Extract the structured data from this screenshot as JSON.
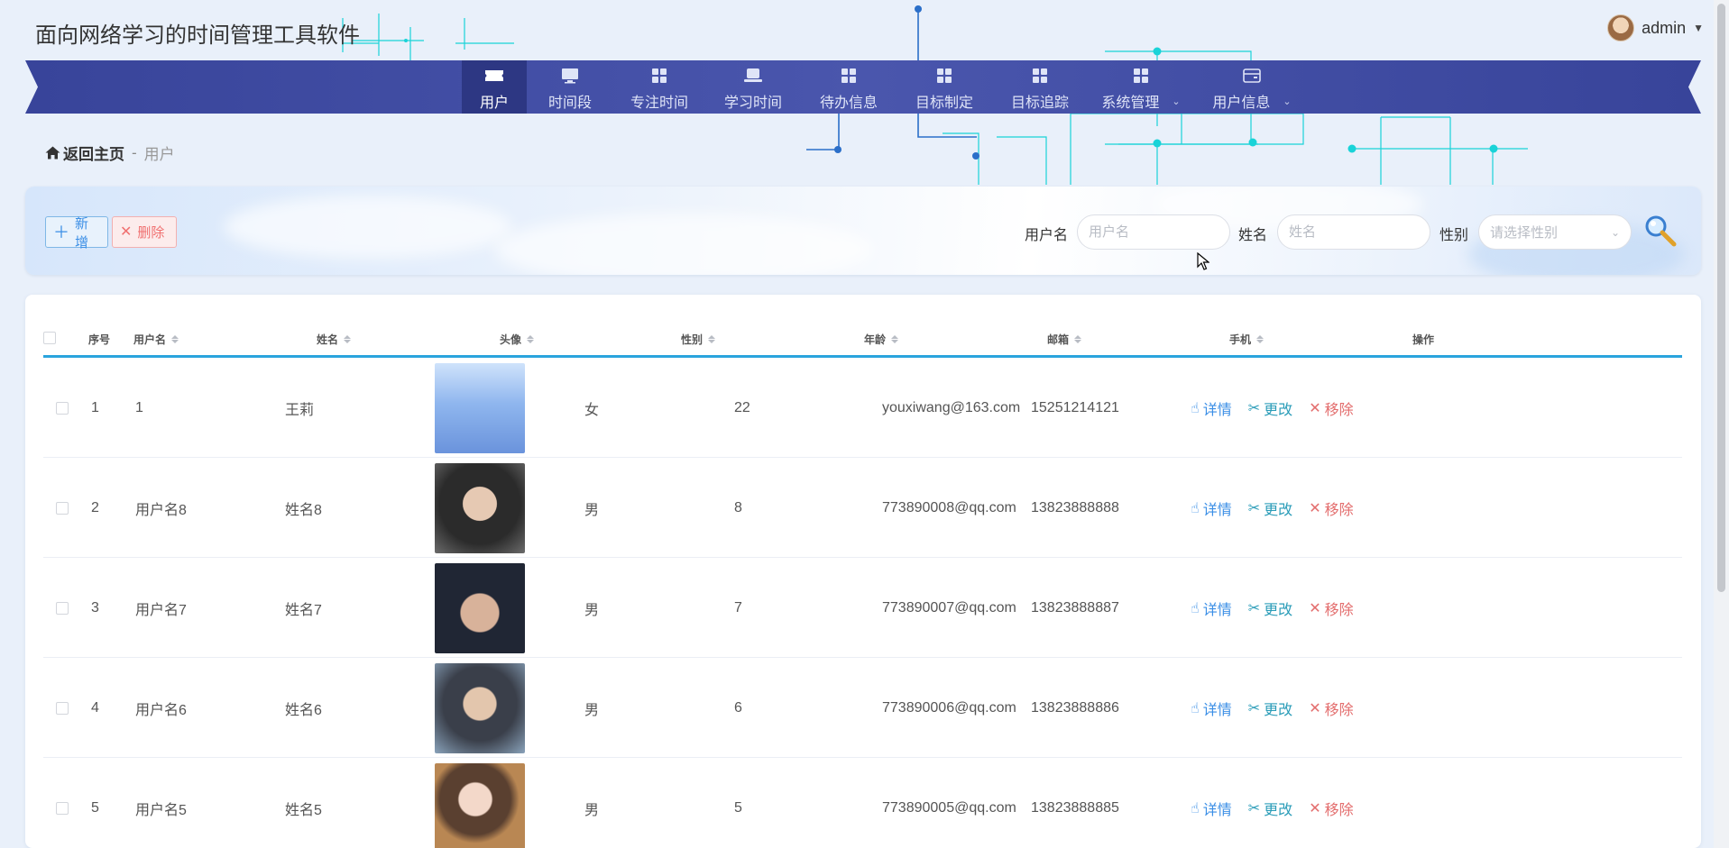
{
  "app": {
    "title": "面向网络学习的时间管理工具软件"
  },
  "user": {
    "name": "admin"
  },
  "nav": {
    "items": [
      {
        "label": "用户",
        "icon": "ticket-icon",
        "active": true,
        "dropdown": false
      },
      {
        "label": "时间段",
        "icon": "monitor-icon",
        "active": false,
        "dropdown": false
      },
      {
        "label": "专注时间",
        "icon": "grid-icon",
        "active": false,
        "dropdown": false
      },
      {
        "label": "学习时间",
        "icon": "laptop-icon",
        "active": false,
        "dropdown": false
      },
      {
        "label": "待办信息",
        "icon": "grid-icon",
        "active": false,
        "dropdown": false
      },
      {
        "label": "目标制定",
        "icon": "grid-icon",
        "active": false,
        "dropdown": false
      },
      {
        "label": "目标追踪",
        "icon": "grid-icon",
        "active": false,
        "dropdown": false
      },
      {
        "label": "系统管理",
        "icon": "grid-icon",
        "active": false,
        "dropdown": true
      },
      {
        "label": "用户信息",
        "icon": "card-icon",
        "active": false,
        "dropdown": true
      }
    ]
  },
  "breadcrumb": {
    "home": "返回主页",
    "separator": "-",
    "current": "用户"
  },
  "toolbar": {
    "add_label": "新增",
    "delete_label": "删除"
  },
  "filters": {
    "username_label": "用户名",
    "username_placeholder": "用户名",
    "name_label": "姓名",
    "name_placeholder": "姓名",
    "gender_label": "性别",
    "gender_placeholder": "请选择性别"
  },
  "table": {
    "columns": [
      "序号",
      "用户名",
      "姓名",
      "头像",
      "性别",
      "年龄",
      "邮箱",
      "手机",
      "操作"
    ],
    "rows": [
      {
        "index": "1",
        "username": "1",
        "name": "王莉",
        "gender": "女",
        "age": "22",
        "email": "youxiwang@163.com",
        "phone": "15251214121"
      },
      {
        "index": "2",
        "username": "用户名8",
        "name": "姓名8",
        "gender": "男",
        "age": "8",
        "email": "773890008@qq.com",
        "phone": "13823888888"
      },
      {
        "index": "3",
        "username": "用户名7",
        "name": "姓名7",
        "gender": "男",
        "age": "7",
        "email": "773890007@qq.com",
        "phone": "13823888887"
      },
      {
        "index": "4",
        "username": "用户名6",
        "name": "姓名6",
        "gender": "男",
        "age": "6",
        "email": "773890006@qq.com",
        "phone": "13823888886"
      },
      {
        "index": "5",
        "username": "用户名5",
        "name": "姓名5",
        "gender": "男",
        "age": "5",
        "email": "773890005@qq.com",
        "phone": "13823888885"
      }
    ],
    "actions": {
      "detail": "详情",
      "edit": "更改",
      "remove": "移除"
    }
  },
  "colors": {
    "navbar": "#3d49a0",
    "nav_active": "#2d3783",
    "table_header_line": "#2aa4dd",
    "link_blue": "#3a8ee6",
    "edit_teal": "#2a9cb8",
    "danger_red": "#e36d6d",
    "circuit_cyan": "#1fd6d6"
  }
}
